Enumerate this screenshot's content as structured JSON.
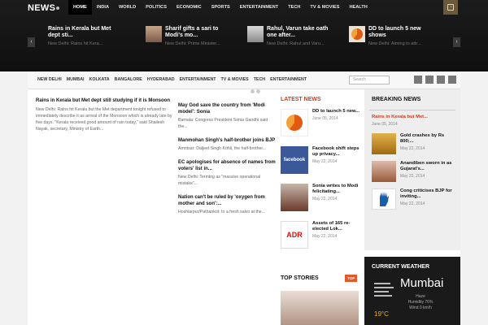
{
  "logo": "NEWS",
  "main_nav": [
    "HOME",
    "INDIA",
    "WORLD",
    "POLITICS",
    "ECONOMIC",
    "SPORTS",
    "ENTERTAINMENT",
    "TECH",
    "TV & MOVIES",
    "HEALTH"
  ],
  "slider": [
    {
      "title": "Rains in Kerala but Met dept sti...",
      "sub": "New Delhi: Rains hit Kera..."
    },
    {
      "title": "Sharif gifts a sari to Modi's mo...",
      "sub": "New Delhi: Prime Minister..."
    },
    {
      "title": "Rahul, Varun take oath one after...",
      "sub": "New Delhi: Rahul and Varu..."
    },
    {
      "title": "DD to launch 5 new shows",
      "sub": "New Delhi: Aiming to attr..."
    }
  ],
  "sub_nav": [
    "NEW DELHI",
    "MUMBAI",
    "KOLKATA",
    "BANGALORE",
    "HYDERABAD",
    "ENTERTAINMENT",
    "TV & MOVIES",
    "TECH",
    "ENTERTAINMENT"
  ],
  "search": {
    "placeholder": "Search"
  },
  "lead_story": {
    "title": "Rains in Kerala but Met dept still studying if it is Monsoon",
    "excerpt": "New Delhi: Rains hit Kerala but the Met department tonight refused to immediately describe it as arrival of the Monsoon which is already late by five days. \"Kerala received good amount of rain today,\" said Shailesh Nayak, secretary, Ministry of Earth..."
  },
  "mid_stories": [
    {
      "title": "May God save the country from 'Modi model': Sonia",
      "excerpt": "Barnala: Congress President Sonia Gandhi said the..."
    },
    {
      "title": "Manmohan Singh's half-brother joins BJP",
      "excerpt": "Amritsar: Daljeet Singh Kohli, the half-brother..."
    },
    {
      "title": "EC apologises for absence of names from voters' list in...",
      "excerpt": "New Delhi: Terming as \"massive operational mistake\"..."
    },
    {
      "title": "Nation can't be ruled by 'oxygen from mother and son':...",
      "excerpt": "Hoshiarpur/Pathankot: In a fresh salvo at the..."
    }
  ],
  "latest_news": {
    "heading": "LATEST NEWS",
    "items": [
      {
        "title": "DD to launch 5 new...",
        "date": "June 05, 2014"
      },
      {
        "title": "Facebook shift steps up privacy...",
        "date": "May 22, 2014"
      },
      {
        "title": "Sonia writes to Modi felicitating...",
        "date": "May 22, 2014"
      },
      {
        "title": "Assets of 165 re-elected Lok...",
        "date": "May 22, 2014"
      }
    ]
  },
  "top_stories": {
    "heading": "TOP STORIES",
    "badge": "TOP"
  },
  "breaking_news": {
    "heading": "BREAKING NEWS",
    "first": {
      "title": "Rains in Kerala but Met...",
      "date": "June 05, 2014"
    },
    "items": [
      {
        "title": "Gold crashes by Rs 800;...",
        "date": "May 22, 2014"
      },
      {
        "title": "Anandiben sworn in as Gujarat's...",
        "date": "May 22, 2014"
      },
      {
        "title": "Cong criticises BJP for inviting...",
        "date": "May 22, 2014"
      }
    ]
  },
  "weather": {
    "heading": "CURRENT WEATHER",
    "city": "Mumbai",
    "condition": "Haze",
    "humidity": "Humidity 76%",
    "wind": "Wind 0 km/h",
    "temp": "19°C"
  },
  "icons": {
    "rss": "rss-icon",
    "twitter": "twitter-icon",
    "facebook": "facebook-icon",
    "google": "google-plus-icon",
    "share": "share-icon",
    "weather": "haze-icon"
  },
  "colors": {
    "accent": "#d23a1a",
    "header_bg": "#111111",
    "badge": "#e2592d",
    "temperature": "#f0b000"
  }
}
